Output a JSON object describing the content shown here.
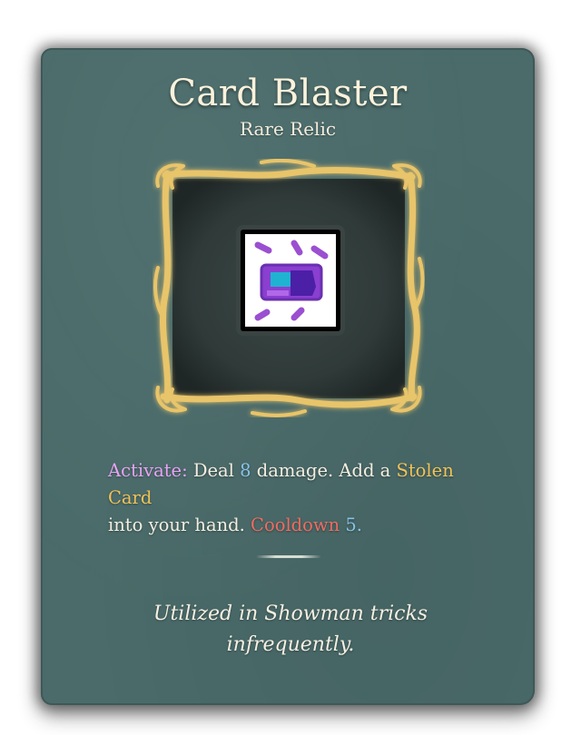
{
  "relic": {
    "name": "Card Blaster",
    "rarity": "Rare Relic",
    "icon": "card-blaster-icon",
    "description": {
      "activate_label": "Activate:",
      "deal_text": "Deal",
      "damage_value": "8",
      "damage_text": "damage. Add a",
      "card_name": "Stolen Card",
      "hand_text": "into your hand.",
      "cooldown_label": "Cooldown",
      "cooldown_value": "5."
    },
    "flavor_line1": "Utilized in Showman tricks",
    "flavor_line2": "infrequently."
  },
  "colors": {
    "card_background": "#4a6b6a",
    "frame_gold": "#e8c46a",
    "frame_inner": "#2f3938",
    "activate_keyword": "#e9a3f5",
    "number_keyword": "#86c3e8",
    "card_keyword": "#f0c35a",
    "cooldown_keyword": "#f06b61"
  }
}
